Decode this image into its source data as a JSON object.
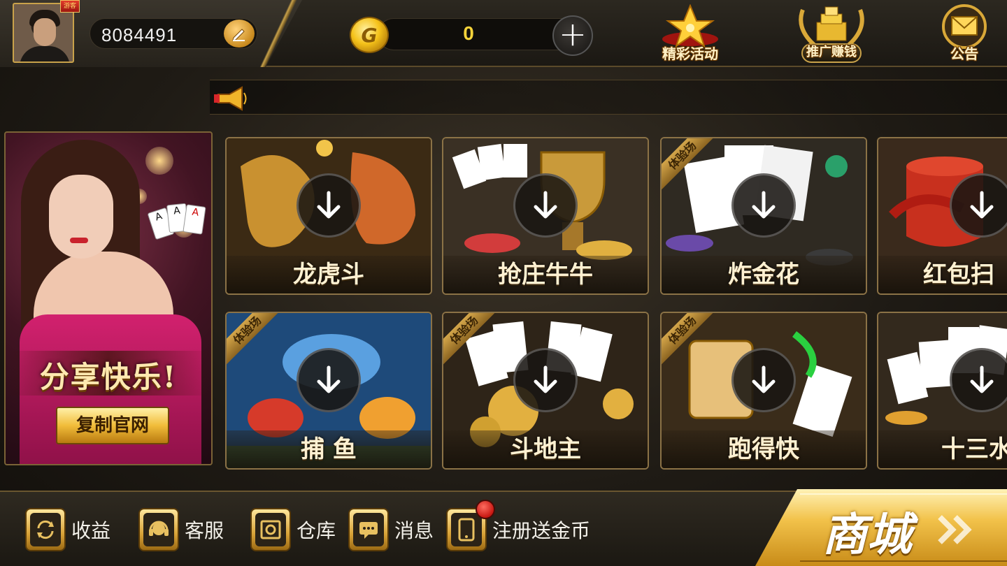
{
  "header": {
    "user_id": "8084491",
    "avatar_badge": "游客",
    "coins": "0",
    "actions": [
      {
        "label": "精彩活动",
        "icon": "star-trophy-icon"
      },
      {
        "label": "推广赚钱",
        "icon": "gold-laurel-icon"
      },
      {
        "label": "公告",
        "icon": "envelope-icon"
      }
    ]
  },
  "marquee": {
    "icon": "megaphone-icon"
  },
  "banner": {
    "title": "分享快乐!",
    "button_label": "复制官网"
  },
  "games": [
    {
      "name": "龙虎斗",
      "trial": false,
      "art": "dragon-tiger"
    },
    {
      "name": "抢庄牛牛",
      "trial": false,
      "art": "trophy-cards"
    },
    {
      "name": "炸金花",
      "trial": true,
      "trial_label": "体验场",
      "art": "aces-chips"
    },
    {
      "name": "红包扫",
      "trial": false,
      "art": "red-envelope"
    },
    {
      "name": "捕 鱼",
      "trial": true,
      "trial_label": "体验场",
      "art": "fish"
    },
    {
      "name": "斗地主",
      "trial": true,
      "trial_label": "体验场",
      "art": "jokers-coins"
    },
    {
      "name": "跑得快",
      "trial": true,
      "trial_label": "体验场",
      "art": "paodekuai"
    },
    {
      "name": "十三水",
      "trial": false,
      "art": "cards-chips"
    }
  ],
  "bottom": {
    "items": [
      {
        "label": "收益",
        "icon": "refresh-icon"
      },
      {
        "label": "客服",
        "icon": "headset-icon"
      },
      {
        "label": "仓库",
        "icon": "safe-icon"
      },
      {
        "label": "消息",
        "icon": "chat-icon"
      },
      {
        "label": "注册送金币",
        "icon": "phone-icon",
        "notification": true
      }
    ],
    "shop_label": "商城"
  },
  "colors": {
    "gold": "#c9a24a",
    "coin_text": "#f5d33a",
    "notification_red": "#c71812"
  }
}
